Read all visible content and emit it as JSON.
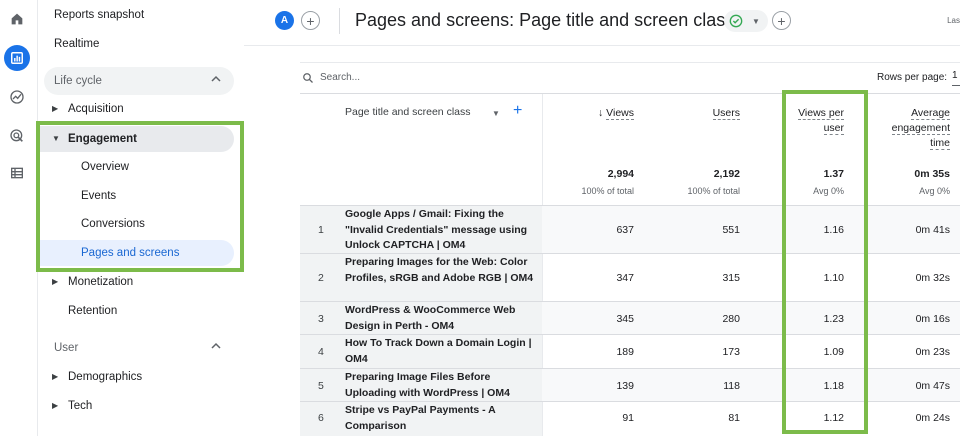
{
  "nav": {
    "reports_snapshot": "Reports snapshot",
    "realtime": "Realtime",
    "lifecycle": "Life cycle",
    "acquisition": "Acquisition",
    "engagement": "Engagement",
    "overview": "Overview",
    "events": "Events",
    "conversions": "Conversions",
    "pages_and_screens": "Pages and screens",
    "monetization": "Monetization",
    "retention": "Retention",
    "user": "User",
    "demographics": "Demographics",
    "tech": "Tech"
  },
  "header": {
    "avatar_letter": "A",
    "title": "Pages and screens: Page title and screen class",
    "last_text": "Las"
  },
  "table": {
    "search_placeholder": "Search...",
    "rows_per_page_label": "Rows per page:",
    "rows_per_page_value": "1",
    "dimension_header": "Page title and screen class",
    "columns": [
      {
        "label": "Views",
        "total": "2,994",
        "sub": "100% of total"
      },
      {
        "label": "Users",
        "total": "2,192",
        "sub": "100% of total"
      },
      {
        "label_line1": "Views per",
        "label_line2": "user",
        "total": "1.37",
        "sub": "Avg 0%"
      },
      {
        "label_line1": "Average",
        "label_line2": "engagement",
        "label_line3": "time",
        "total": "0m 35s",
        "sub": "Avg 0%"
      }
    ],
    "rows": [
      {
        "num": "1",
        "title": "Google Apps / Gmail: Fixing the \"Invalid Credentials\" message using Unlock CAPTCHA | OM4",
        "views": "637",
        "users": "551",
        "vpu": "1.16",
        "time": "0m 41s"
      },
      {
        "num": "2",
        "title": "Preparing Images for the Web: Color Profiles, sRGB and Adobe RGB | OM4",
        "views": "347",
        "users": "315",
        "vpu": "1.10",
        "time": "0m 32s"
      },
      {
        "num": "3",
        "title": "WordPress & WooCommerce Web Design in Perth - OM4",
        "views": "345",
        "users": "280",
        "vpu": "1.23",
        "time": "0m 16s"
      },
      {
        "num": "4",
        "title": "How To Track Down a Domain Login | OM4",
        "views": "189",
        "users": "173",
        "vpu": "1.09",
        "time": "0m 23s"
      },
      {
        "num": "5",
        "title": "Preparing Image Files Before Uploading with WordPress | OM4",
        "views": "139",
        "users": "118",
        "vpu": "1.18",
        "time": "0m 47s"
      },
      {
        "num": "6",
        "title": "Stripe vs PayPal Payments - A Comparison",
        "views": "91",
        "users": "81",
        "vpu": "1.12",
        "time": "0m 24s"
      }
    ]
  },
  "colors": {
    "accent": "#1a73e8",
    "highlight_box": "#7cbb4a",
    "status_ok": "#34a853"
  }
}
